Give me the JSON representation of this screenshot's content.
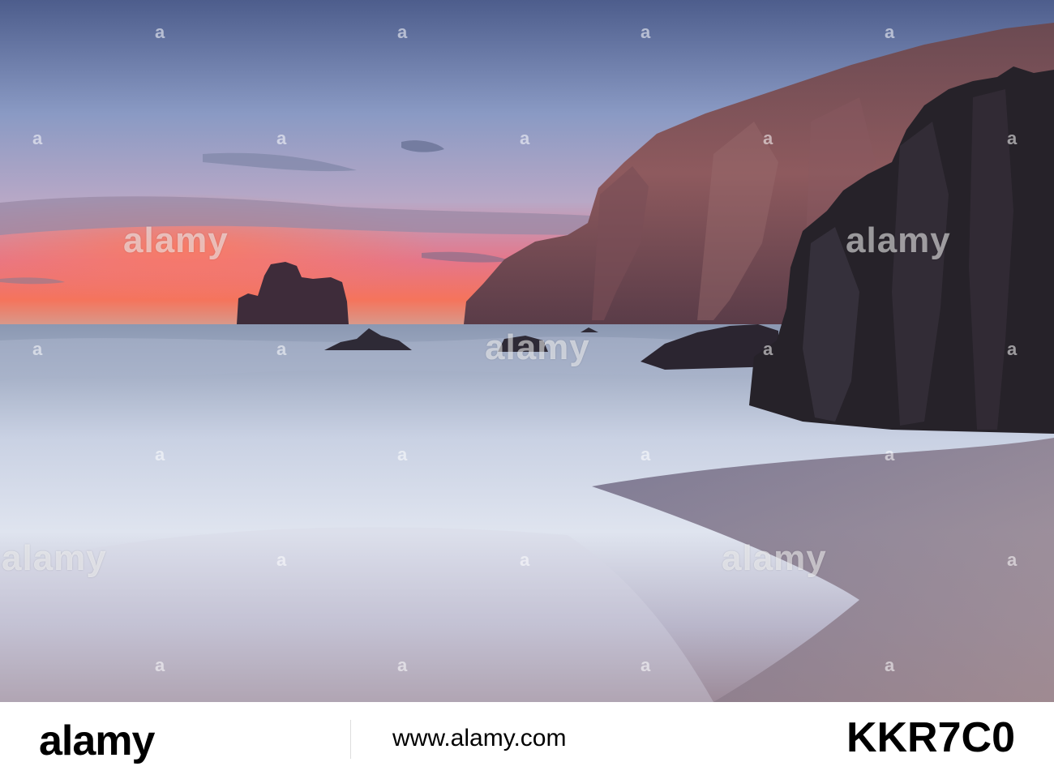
{
  "watermark": {
    "brand_text": "alamy",
    "letter": "a"
  },
  "footer": {
    "logo_text": "alamy",
    "image_id": "KKR7C0",
    "url_text": "www.alamy.com"
  }
}
